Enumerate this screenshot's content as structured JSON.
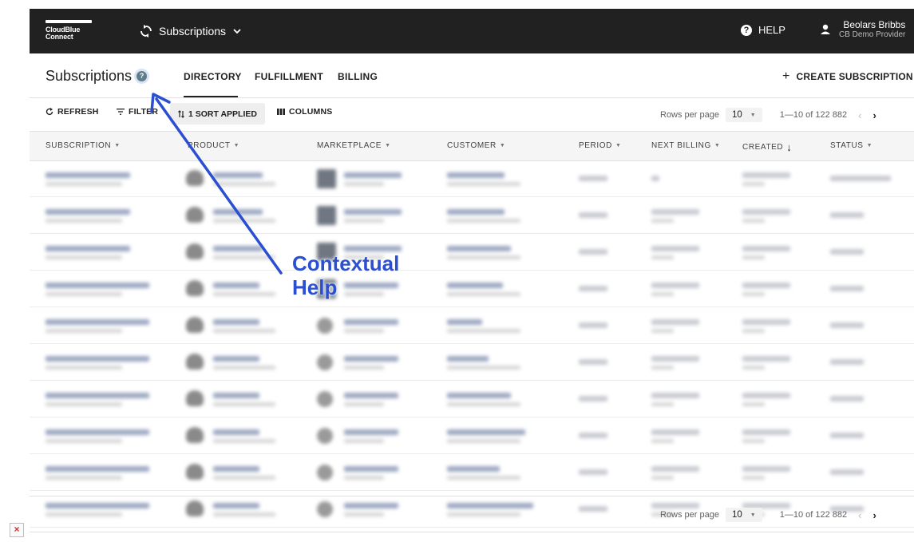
{
  "topbar": {
    "logo_line1": "CloudBlue",
    "logo_line2": "Connect",
    "module_label": "Subscriptions",
    "help_label": "HELP",
    "user_name": "Beolars Bribbs",
    "user_org": "CB Demo Provider"
  },
  "header": {
    "title": "Subscriptions",
    "context_help_glyph": "?",
    "tabs": [
      "DIRECTORY",
      "FULFILLMENT",
      "BILLING"
    ],
    "active_tab": "DIRECTORY",
    "create_label": "CREATE SUBSCRIPTION",
    "create_glyph": "+"
  },
  "toolbar": {
    "refresh_label": "REFRESH",
    "filter_label": "FILTER",
    "sort_label": "1 SORT APPLIED",
    "columns_label": "COLUMNS"
  },
  "pagination": {
    "rows_per_page_label": "Rows per page",
    "rows_per_page_value": "10",
    "range_text": "1—10 of 122 882"
  },
  "table": {
    "columns": [
      "SUBSCRIPTION",
      "PRODUCT",
      "MARKETPLACE",
      "CUSTOMER",
      "PERIOD",
      "NEXT BILLING",
      "CREATED",
      "STATUS"
    ],
    "sorted_column": "CREATED",
    "row_count_visible": 10,
    "content_blurred": true
  },
  "annotation": {
    "line1": "Contextual",
    "line2": "Help",
    "color": "#2b4fd1"
  },
  "colors": {
    "topbar": "#212121",
    "accent": "#2b4fd1"
  }
}
